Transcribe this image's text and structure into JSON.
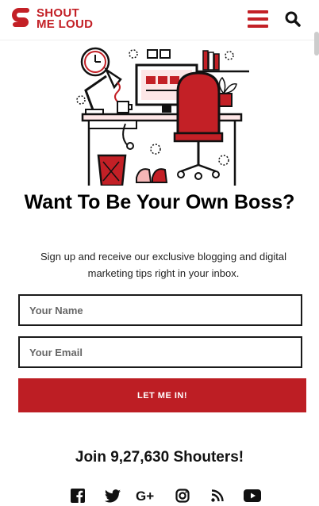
{
  "brand": {
    "line1": "SHOUT",
    "line2": "ME LOUD",
    "color": "#c32026"
  },
  "header": {
    "menu_icon": "hamburger-icon",
    "search_icon": "search-icon"
  },
  "hero": {
    "title": "Want To Be Your Own Boss?",
    "subtitle": "Sign up and receive our exclusive blogging and digital marketing tips right in your inbox."
  },
  "form": {
    "name_placeholder": "Your Name",
    "email_placeholder": "Your Email",
    "submit_label": "LET ME IN!",
    "button_color": "#bd1e24"
  },
  "community": {
    "join_text": "Join 9,27,630 Shouters!"
  },
  "social": [
    "facebook-icon",
    "twitter-icon",
    "google-plus-icon",
    "instagram-icon",
    "rss-icon",
    "youtube-icon"
  ]
}
